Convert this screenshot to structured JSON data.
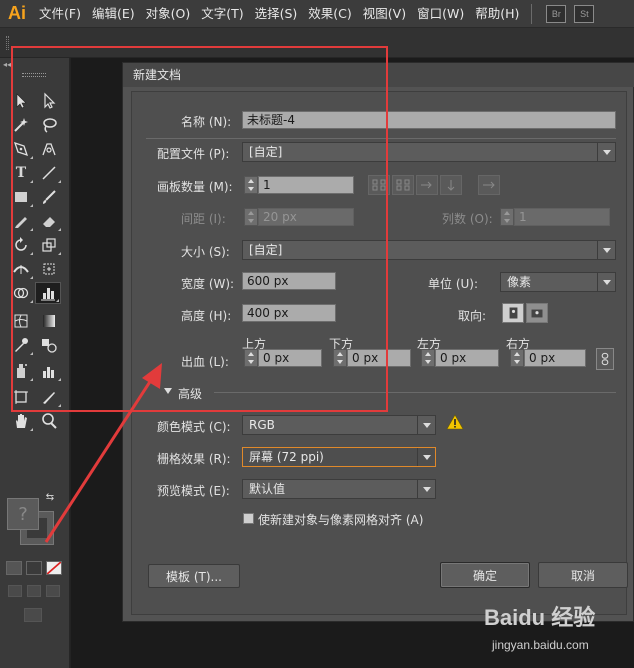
{
  "app": {
    "logo": "Ai",
    "badge_br": "Br",
    "badge_st": "St"
  },
  "menu": [
    "文件(F)",
    "编辑(E)",
    "对象(O)",
    "文字(T)",
    "选择(S)",
    "效果(C)",
    "视图(V)",
    "窗口(W)",
    "帮助(H)"
  ],
  "dialog": {
    "title": "新建文档",
    "name_label": "名称 (N):",
    "name_value": "未标题-4",
    "profile_label": "配置文件 (P):",
    "profile_value": "[自定]",
    "artboards_label": "画板数量 (M):",
    "artboards_value": "1",
    "spacing_label": "间距 (I):",
    "spacing_value": "20 px",
    "columns_label": "列数 (O):",
    "columns_value": "1",
    "size_label": "大小 (S):",
    "size_value": "[自定]",
    "width_label": "宽度 (W):",
    "width_value": "600 px",
    "units_label": "单位 (U):",
    "units_value": "像素",
    "height_label": "高度 (H):",
    "height_value": "400 px",
    "orientation_label": "取向:",
    "bleed_label": "出血 (L):",
    "bleed": {
      "top_label": "上方",
      "top_value": "0 px",
      "bottom_label": "下方",
      "bottom_value": "0 px",
      "left_label": "左方",
      "left_value": "0 px",
      "right_label": "右方",
      "right_value": "0 px"
    },
    "advanced_label": "高级",
    "color_mode_label": "颜色模式 (C):",
    "color_mode_value": "RGB",
    "raster_label": "栅格效果 (R):",
    "raster_value": "屏幕 (72 ppi)",
    "preview_label": "预览模式 (E):",
    "preview_value": "默认值",
    "align_checkbox_label": "使新建对象与像素网格对齐 (A)",
    "align_checked": false,
    "templates_button": "模板 (T)...",
    "ok_button": "确定",
    "cancel_button": "取消"
  },
  "watermark": {
    "logo": "Baidu 经验",
    "url": "jingyan.baidu.com"
  },
  "colors": {
    "highlight": "#e23b3b",
    "accent": "#f7a31c",
    "focus": "#e0892a",
    "warning": "#f2c500"
  }
}
